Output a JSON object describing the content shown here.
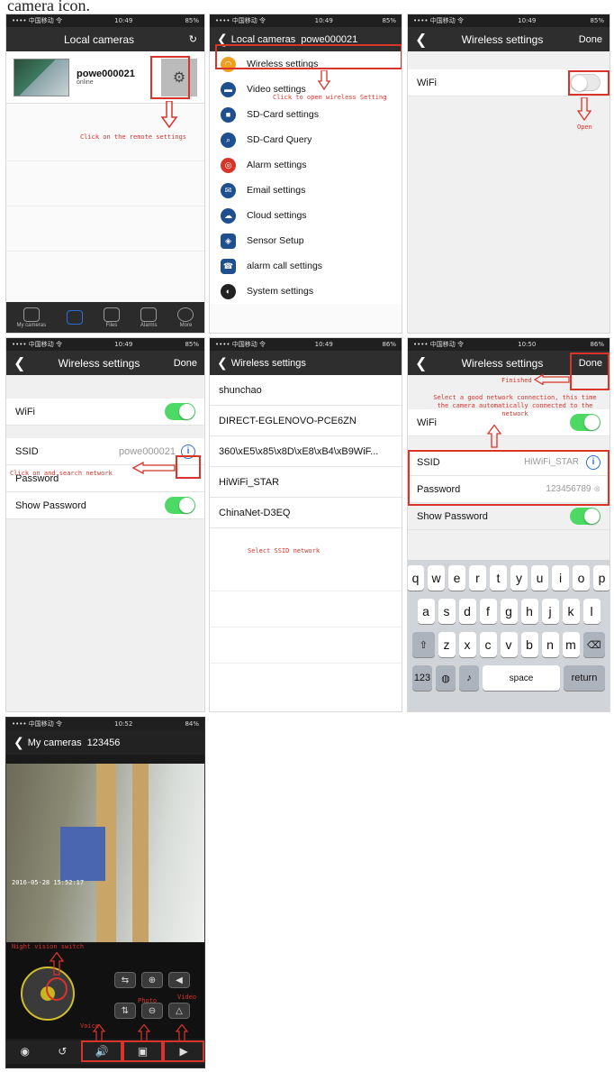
{
  "caption": "camera icon.",
  "p1": {
    "status": {
      "carrier": "•••• 中国移动 令",
      "time": "10:49",
      "battery": "85%"
    },
    "title": "Local cameras",
    "camera_name": "powe000021",
    "camera_status": "online",
    "annotation": "Click on the remote settings",
    "tabs": [
      "My cameras",
      "",
      "Files",
      "Alarms",
      "More"
    ]
  },
  "p2": {
    "status": {
      "carrier": "•••• 中国移动 令",
      "time": "10:49",
      "battery": "85%"
    },
    "back_label": "Local cameras",
    "title": "powe000021",
    "annotation": "Click to open wireless Setting",
    "menu": [
      {
        "label": "Wireless settings",
        "color": "#f0a020"
      },
      {
        "label": "Video settings",
        "color": "#1f4f8f"
      },
      {
        "label": "SD-Card settings",
        "color": "#1f4f8f"
      },
      {
        "label": "SD-Card Query",
        "color": "#1f4f8f"
      },
      {
        "label": "Alarm settings",
        "color": "#d9342a"
      },
      {
        "label": "Email settings",
        "color": "#1f4f8f"
      },
      {
        "label": "Cloud settings",
        "color": "#1f4f8f"
      },
      {
        "label": "Sensor Setup",
        "color": "#1f4f8f"
      },
      {
        "label": "alarm call settings",
        "color": "#1f4f8f"
      },
      {
        "label": "System settings",
        "color": "#1f4f8f"
      }
    ]
  },
  "p3": {
    "status": {
      "carrier": "•••• 中国移动 令",
      "time": "10:49",
      "battery": "85%"
    },
    "title": "Wireless settings",
    "done": "Done",
    "wifi_label": "WiFi",
    "annotation": "Open"
  },
  "p4": {
    "status": {
      "carrier": "•••• 中国移动 令",
      "time": "10:49",
      "battery": "85%"
    },
    "title": "Wireless settings",
    "done": "Done",
    "wifi_label": "WiFi",
    "ssid_label": "SSID",
    "ssid_value": "powe000021",
    "password_label": "Password",
    "show_password_label": "Show Password",
    "annotation": "Click on and search network"
  },
  "p5": {
    "status": {
      "carrier": "•••• 中国移动 令",
      "time": "10:49",
      "battery": "86%"
    },
    "back_label": "Wireless settings",
    "networks": [
      "shunchao",
      "DIRECT-EGLENOVO-PCE6ZN",
      "360\\xE5\\x85\\x8D\\xE8\\xB4\\xB9WiF...",
      "HiWiFi_STAR",
      "ChinaNet-D3EQ"
    ],
    "annotation": "Select SSID network"
  },
  "p6": {
    "status": {
      "carrier": "•••• 中国移动 令",
      "time": "10:50",
      "battery": "86%"
    },
    "title": "Wireless settings",
    "done": "Done",
    "done_annotation": "Finished",
    "annotation": "Select a good network connection, this time the camera automatically connected to the network",
    "wifi_label": "WiFi",
    "ssid_label": "SSID",
    "ssid_value": "HiWiFi_STAR",
    "password_label": "Password",
    "password_value": "123456789",
    "show_password_label": "Show Password",
    "keyboard": {
      "row1": [
        "q",
        "w",
        "e",
        "r",
        "t",
        "y",
        "u",
        "i",
        "o",
        "p"
      ],
      "row2": [
        "a",
        "s",
        "d",
        "f",
        "g",
        "h",
        "j",
        "k",
        "l"
      ],
      "row3": [
        "z",
        "x",
        "c",
        "v",
        "b",
        "n",
        "m"
      ],
      "num": "123",
      "space": "space",
      "return": "return"
    }
  },
  "p7": {
    "status": {
      "carrier": "•••• 中国移动 令",
      "time": "10:52",
      "battery": "84%"
    },
    "back_label": "My cameras",
    "title": "123456",
    "timestamp": "2016-05-28 15:52:17",
    "annotations": {
      "night": "Night vision switch",
      "voice": "Voice",
      "photo": "Photo",
      "video": "Video"
    }
  }
}
